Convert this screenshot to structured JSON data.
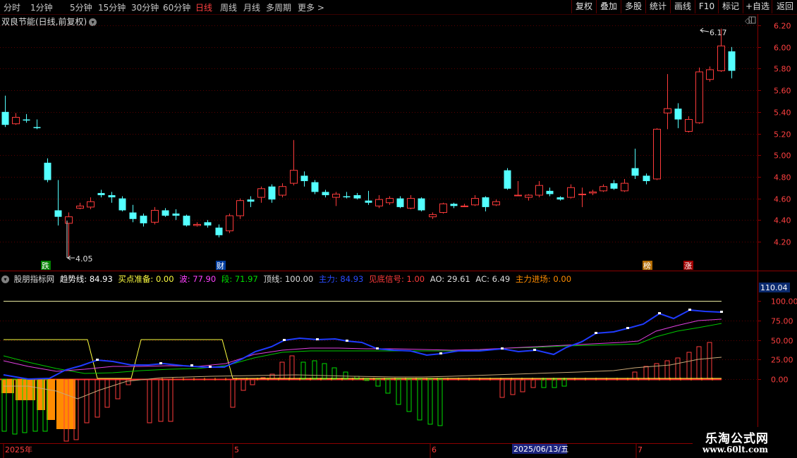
{
  "toolbar": {
    "periods": [
      "分时",
      "1分钟",
      "5分钟",
      "15分钟",
      "30分钟",
      "60分钟",
      "日线",
      "周线",
      "月线",
      "多周期",
      "更多 >"
    ],
    "active_period": "日线",
    "right_buttons": [
      "复权",
      "叠加",
      "多股",
      "统计",
      "画线",
      "F10",
      "标记",
      "+自选",
      "返回"
    ]
  },
  "stock": {
    "title": "双良节能(日线,前复权)",
    "high_label": "6.17",
    "low_label": "4.05"
  },
  "markers": {
    "m1": "跌",
    "m2": "财",
    "m3": "榜",
    "m4": "涨"
  },
  "indicator": {
    "name": "股朋指标网",
    "trend": "趋势线: 84.93",
    "buy_prep": "买点准备: 0.00",
    "wave": "波: 77.90",
    "segment": "段: 71.97",
    "top_line": "顶线: 100.00",
    "main_force": "主力: 84.93",
    "bottom_signal": "见底信号: 1.00",
    "ao": "AO: 29.61",
    "ac": "AC: 6.49",
    "main_entry": "主力进场: 0.00",
    "scale_badge": "110.04"
  },
  "date_axis": {
    "d1": "2025年",
    "d2": "5",
    "d3": "6",
    "d4": "2025/06/13/五",
    "d5": "7"
  },
  "watermark": {
    "line1": "乐淘公式网",
    "line2": "www.60lt.com"
  },
  "colors": {
    "up": "#ff3b3b",
    "down": "#54ffff",
    "blue": "#1f3bff",
    "yellow": "#ffff40",
    "orange": "#ff8c00",
    "green": "#00e000",
    "magenta": "#ff40ff"
  },
  "chart_data": {
    "type": "candlestick",
    "price_ticks": [
      6.2,
      6.0,
      5.8,
      5.6,
      5.4,
      5.2,
      5.0,
      4.8,
      4.6,
      4.4,
      4.2
    ],
    "price_ylim": [
      4.0,
      6.25
    ],
    "candles": [
      [
        5.4,
        5.28,
        5.55,
        5.26
      ],
      [
        5.29,
        5.35,
        5.39,
        5.28
      ],
      [
        5.33,
        5.32,
        5.38,
        5.3
      ],
      [
        5.26,
        5.25,
        5.33,
        5.24
      ],
      [
        4.93,
        4.77,
        4.97,
        4.75
      ],
      [
        4.49,
        4.43,
        4.77,
        4.35
      ],
      [
        4.37,
        4.43,
        4.47,
        4.05
      ],
      [
        4.51,
        4.53,
        4.56,
        4.5
      ],
      [
        4.52,
        4.57,
        4.61,
        4.5
      ],
      [
        4.65,
        4.63,
        4.68,
        4.61
      ],
      [
        4.63,
        4.61,
        4.66,
        4.56
      ],
      [
        4.6,
        4.49,
        4.62,
        4.48
      ],
      [
        4.47,
        4.41,
        4.54,
        4.38
      ],
      [
        4.44,
        4.37,
        4.46,
        4.34
      ],
      [
        4.38,
        4.49,
        4.52,
        4.36
      ],
      [
        4.49,
        4.44,
        4.51,
        4.43
      ],
      [
        4.46,
        4.44,
        4.5,
        4.4
      ],
      [
        4.44,
        4.35,
        4.45,
        4.34
      ],
      [
        4.35,
        4.36,
        4.38,
        4.34
      ],
      [
        4.38,
        4.35,
        4.4,
        4.33
      ],
      [
        4.33,
        4.26,
        4.36,
        4.24
      ],
      [
        4.3,
        4.44,
        4.46,
        4.28
      ],
      [
        4.44,
        4.58,
        4.6,
        4.41
      ],
      [
        4.59,
        4.57,
        4.62,
        4.52
      ],
      [
        4.61,
        4.69,
        4.71,
        4.56
      ],
      [
        4.71,
        4.59,
        4.73,
        4.56
      ],
      [
        4.63,
        4.71,
        4.74,
        4.61
      ],
      [
        4.74,
        4.86,
        5.14,
        4.72
      ],
      [
        4.81,
        4.76,
        4.85,
        4.71
      ],
      [
        4.75,
        4.66,
        4.77,
        4.64
      ],
      [
        4.66,
        4.63,
        4.68,
        4.61
      ],
      [
        4.61,
        4.64,
        4.66,
        4.53
      ],
      [
        4.62,
        4.61,
        4.66,
        4.6
      ],
      [
        4.63,
        4.6,
        4.65,
        4.59
      ],
      [
        4.58,
        4.56,
        4.67,
        4.54
      ],
      [
        4.53,
        4.59,
        4.63,
        4.51
      ],
      [
        4.56,
        4.6,
        4.62,
        4.54
      ],
      [
        4.6,
        4.52,
        4.62,
        4.51
      ],
      [
        4.51,
        4.6,
        4.63,
        4.5
      ],
      [
        4.6,
        4.49,
        4.61,
        4.48
      ],
      [
        4.43,
        4.45,
        4.47,
        4.41
      ],
      [
        4.47,
        4.55,
        4.56,
        4.46
      ],
      [
        4.55,
        4.53,
        4.56,
        4.51
      ],
      [
        4.53,
        4.53,
        4.55,
        4.52
      ],
      [
        4.54,
        4.6,
        4.63,
        4.53
      ],
      [
        4.61,
        4.52,
        4.62,
        4.48
      ],
      [
        4.54,
        4.57,
        4.59,
        4.53
      ],
      [
        4.86,
        4.69,
        4.88,
        4.68
      ],
      [
        4.63,
        4.63,
        4.76,
        4.62
      ],
      [
        4.61,
        4.63,
        4.64,
        4.58
      ],
      [
        4.63,
        4.72,
        4.76,
        4.61
      ],
      [
        4.67,
        4.64,
        4.7,
        4.62
      ],
      [
        4.61,
        4.59,
        4.62,
        4.58
      ],
      [
        4.61,
        4.7,
        4.73,
        4.6
      ],
      [
        4.64,
        4.64,
        4.7,
        4.52
      ],
      [
        4.65,
        4.66,
        4.68,
        4.63
      ],
      [
        4.67,
        4.71,
        4.73,
        4.66
      ],
      [
        4.74,
        4.69,
        4.77,
        4.68
      ],
      [
        4.67,
        4.74,
        4.78,
        4.66
      ],
      [
        4.88,
        4.81,
        5.06,
        4.78
      ],
      [
        4.81,
        4.76,
        4.83,
        4.73
      ],
      [
        4.78,
        5.24,
        5.25,
        4.77
      ],
      [
        5.39,
        5.43,
        5.75,
        5.24
      ],
      [
        5.43,
        5.33,
        5.48,
        5.25
      ],
      [
        5.22,
        5.33,
        5.36,
        5.21
      ],
      [
        5.3,
        5.77,
        5.81,
        5.29
      ],
      [
        5.7,
        5.79,
        5.82,
        5.68
      ],
      [
        5.78,
        6.01,
        6.17,
        5.77
      ],
      [
        5.96,
        5.78,
        6.0,
        5.71
      ]
    ],
    "indicator_ticks": [
      100.0,
      75.0,
      50.0,
      25.0,
      0.0
    ],
    "indicator_ylim": [
      -70,
      110
    ]
  }
}
